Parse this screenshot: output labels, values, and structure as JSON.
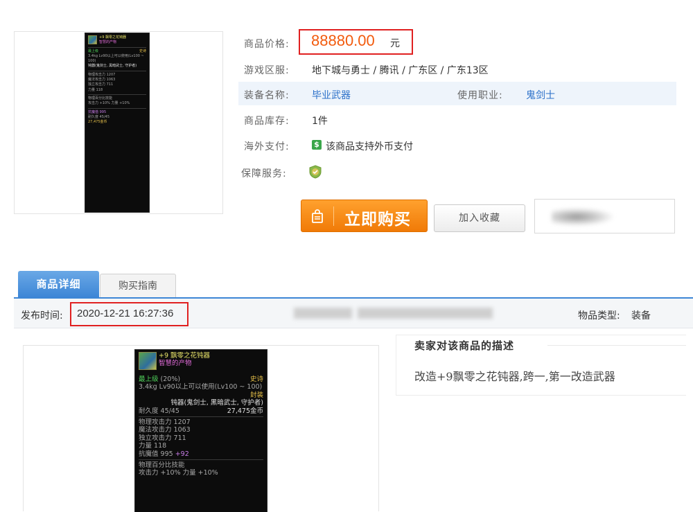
{
  "product": {
    "price_label": "商品价格:",
    "price": "88880.00",
    "price_unit": "元",
    "server_label": "游戏区服:",
    "server_value": "地下城与勇士 / 腾讯 / 广东区 / 广东13区",
    "equip_label": "装备名称:",
    "equip_value": "毕业武器",
    "class_label": "使用职业:",
    "class_value": "鬼剑士",
    "stock_label": "商品库存:",
    "stock_value": "1件",
    "overseas_label": "海外支付:",
    "overseas_value": "该商品支持外币支付",
    "guarantee_label": "保障服务:",
    "buy_label": "立即购买",
    "favorite_label": "加入收藏"
  },
  "tabs": [
    {
      "label": "商品详细"
    },
    {
      "label": "购买指南"
    }
  ],
  "info_bar": {
    "publish_label": "发布时间:",
    "publish_time": "2020-12-21 16:27:36",
    "type_label": "物品类型:",
    "type_value": "装备"
  },
  "seller": {
    "title": "卖家对该商品的描述",
    "text": "改造+9飘零之花钝器,跨一,第一改造武器"
  },
  "game_card": {
    "name": "+9 飘零之花钝器",
    "subtitle": "智慧的产物",
    "rarity": "最上级",
    "rarity_pct": "(20%)",
    "grade": "史诗",
    "weight_req": "3.4kg  Lv90以上可以使用(Lv100 ~ 100)",
    "bound": "封装",
    "type_line": "钝器(鬼剑士, 黑暗武士, 守护者)",
    "durability": "耐久度 45/45",
    "gold": "27,475金币",
    "phys_atk": "物理攻击力 1207",
    "mag_atk": "魔法攻击力 1063",
    "ind_atk": "独立攻击力 711",
    "str": "力量 118",
    "debuff": "抗魔值 995",
    "debuff_bonus": "+92",
    "skill": "物理百分比技能",
    "skill2": "攻击力 +10%  力量 +10%"
  },
  "colors": {
    "price": "#f25a0c",
    "accent": "#3d86d6",
    "buy_button": "#f07a07",
    "highlight_box": "#e02020",
    "link": "#2a6fc9"
  },
  "icons": [
    "shopping-bag-icon",
    "dollar-icon",
    "shield-icon"
  ]
}
